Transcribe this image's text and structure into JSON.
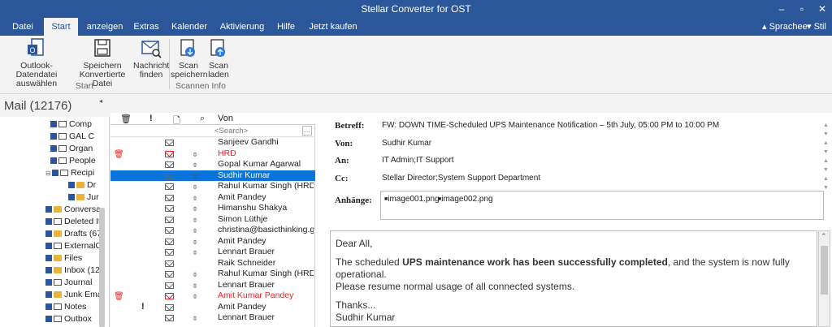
{
  "window": {
    "title": "Stellar Converter for OST"
  },
  "menu": {
    "tabs": [
      "Datei",
      "Start",
      "anzeigen",
      "Extras",
      "Kalender",
      "Aktivierung",
      "Hilfe",
      "Jetzt kaufen"
    ],
    "active": "Start",
    "sprache": "Sprachee",
    "stil": "Stil"
  },
  "ribbon": {
    "buttons": {
      "outlook": "Outlook-Datendatei\nauswählen",
      "save": "Speichern\nKonvertierte Datei",
      "find": "Nachricht\nfinden",
      "scan_save": "Scan\nspeichern",
      "scan_load": "Scan\nladen"
    },
    "groups": {
      "start": "Start",
      "scan_info": "Scannen Info"
    }
  },
  "folders": {
    "header": "Mail (12176)",
    "items": [
      "Comp",
      "GAL C",
      "Organ",
      "People",
      "Recipi",
      "Dr",
      "Jur",
      "Conversa",
      "Deleted It",
      "Drafts (67",
      "ExternalC",
      "Files",
      "Inbox (12",
      "Journal",
      "Junk Ema",
      "Notes",
      "Outbox"
    ]
  },
  "list": {
    "header_from": "Von",
    "search_placeholder": "<Search>",
    "rows": [
      {
        "from": "Sanjeev Gandhi"
      },
      {
        "from": "HRD"
      },
      {
        "from": "Gopal Kumar Agarwal"
      },
      {
        "from": "Sudhir Kumar"
      },
      {
        "from": "Rahul Kumar Singh (HRD)"
      },
      {
        "from": "Amit Pandey"
      },
      {
        "from": "Himanshu Shakya"
      },
      {
        "from": "Simon Lüthje"
      },
      {
        "from": "christina@basicthinking.gmbh"
      },
      {
        "from": "Amit Pandey"
      },
      {
        "from": "Lennart Brauer"
      },
      {
        "from": "Raik Schneider"
      },
      {
        "from": "Rahul Kumar Singh (HRD)"
      },
      {
        "from": "Lennart Brauer"
      },
      {
        "from": "Amit Kumar Pandey"
      },
      {
        "from": "Amit Pandey"
      },
      {
        "from": "Lennart Brauer"
      }
    ]
  },
  "reading": {
    "labels": {
      "subject": "Betreff:",
      "from": "Von:",
      "to": "An:",
      "cc": "Cc:",
      "attachments": "Anhänge:"
    },
    "subject": "FW: DOWN TIME-Scheduled UPS Maintenance Notification – 5th July, 05:00 PM to 10:00 PM",
    "from": "Sudhir Kumar",
    "to": "IT Admin;IT Support",
    "cc": "Stellar Director;System Support Department",
    "attachments": [
      "image001.png",
      "image002.png"
    ],
    "body": {
      "greeting": "Dear All,",
      "line1_pre": "The scheduled ",
      "line1_bold": "UPS maintenance work has been successfully completed",
      "line1_post": ", and the system is now fully operational.",
      "line2": "Please resume normal usage of all connected systems.",
      "thanks": "Thanks...",
      "signature": "Sudhir Kumar"
    }
  }
}
